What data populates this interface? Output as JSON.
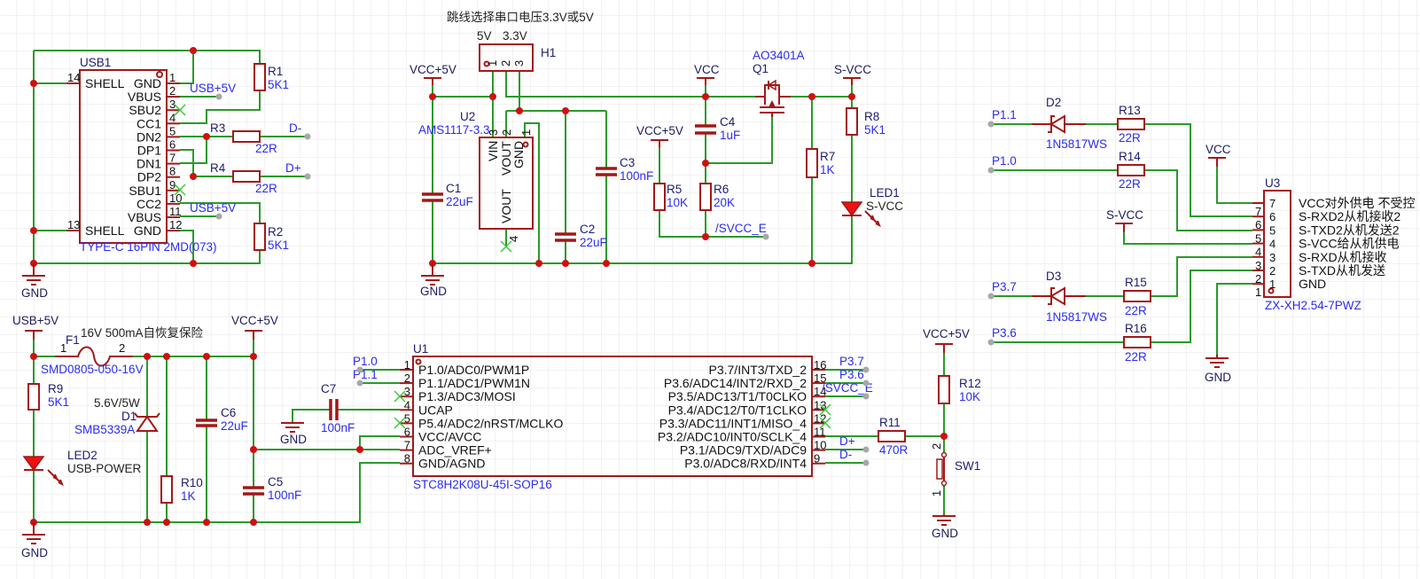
{
  "note": "跳线选择串口电压3.3V或5V",
  "nets": {
    "usb5v": "USB+5V",
    "vcc5v": "VCC+5V",
    "vcc": "VCC",
    "svcc": "S-VCC",
    "gnd": "GND",
    "dm": "D-",
    "dp": "D+",
    "p10": "P1.0",
    "p11": "P1.1",
    "p37": "P3.7",
    "p36": "P3.6",
    "svcc_e": "/SVCC_E"
  },
  "usb1": {
    "ref": "USB1",
    "part": "TYPE-C 16PIN 2MD(073)",
    "pins_right": [
      {
        "num": "1",
        "name": "GND"
      },
      {
        "num": "2",
        "name": "VBUS"
      },
      {
        "num": "3",
        "name": "SBU2"
      },
      {
        "num": "4",
        "name": "CC1"
      },
      {
        "num": "5",
        "name": "DN2"
      },
      {
        "num": "6",
        "name": "DP1"
      },
      {
        "num": "7",
        "name": "DN1"
      },
      {
        "num": "8",
        "name": "DP2"
      },
      {
        "num": "9",
        "name": "SBU1"
      },
      {
        "num": "10",
        "name": "CC2"
      },
      {
        "num": "11",
        "name": "VBUS"
      },
      {
        "num": "12",
        "name": "GND"
      }
    ],
    "pins_left": [
      {
        "num": "14",
        "name": "SHELL"
      },
      {
        "num": "13",
        "name": "SHELL"
      }
    ]
  },
  "h1": {
    "ref": "H1",
    "opt_a": "5V",
    "opt_b": "3.3V",
    "pins": [
      "1",
      "2",
      "3"
    ]
  },
  "u2": {
    "ref": "U2",
    "part": "AMS1117-3.3",
    "pins": [
      {
        "num": "3",
        "name": "VIN"
      },
      {
        "num": "2",
        "name": "VOUT"
      },
      {
        "num": "1",
        "name": "GND"
      },
      {
        "num": "4",
        "name": "VOUT"
      }
    ]
  },
  "q1": {
    "ref": "Q1",
    "part": "AO3401A"
  },
  "r": {
    "r1": {
      "ref": "R1",
      "value": "5K1"
    },
    "r2": {
      "ref": "R2",
      "value": "5K1"
    },
    "r3": {
      "ref": "R3",
      "value": "22R"
    },
    "r4": {
      "ref": "R4",
      "value": "22R"
    },
    "r5": {
      "ref": "R5",
      "value": "10K"
    },
    "r6": {
      "ref": "R6",
      "value": "20K"
    },
    "r7": {
      "ref": "R7",
      "value": "1K"
    },
    "r8": {
      "ref": "R8",
      "value": "5K1"
    },
    "r9": {
      "ref": "R9",
      "value": "5K1"
    },
    "r10": {
      "ref": "R10",
      "value": "1K"
    },
    "r11": {
      "ref": "R11",
      "value": "470R"
    },
    "r12": {
      "ref": "R12",
      "value": "10K"
    },
    "r13": {
      "ref": "R13",
      "value": "22R"
    },
    "r14": {
      "ref": "R14",
      "value": "22R"
    },
    "r15": {
      "ref": "R15",
      "value": "22R"
    },
    "r16": {
      "ref": "R16",
      "value": "22R"
    }
  },
  "c": {
    "c1": {
      "ref": "C1",
      "value": "22uF"
    },
    "c2": {
      "ref": "C2",
      "value": "22uF"
    },
    "c3": {
      "ref": "C3",
      "value": "100nF"
    },
    "c4": {
      "ref": "C4",
      "value": "1uF"
    },
    "c5": {
      "ref": "C5",
      "value": "100nF"
    },
    "c6": {
      "ref": "C6",
      "value": "22uF"
    },
    "c7": {
      "ref": "C7",
      "value": "100nF"
    }
  },
  "d": {
    "d1": {
      "ref": "D1",
      "value": "SMB5339A",
      "rating": "5.6V/5W"
    },
    "d2": {
      "ref": "D2",
      "value": "1N5817WS"
    },
    "d3": {
      "ref": "D3",
      "value": "1N5817WS"
    },
    "led1": {
      "ref": "LED1",
      "value": "S-VCC"
    },
    "led2": {
      "ref": "LED2",
      "value": "USB-POWER"
    }
  },
  "f1": {
    "ref": "F1",
    "value": "SMD0805-050-16V",
    "note": "16V 500mA自恢复保险",
    "pin1": "1",
    "pin2": "2"
  },
  "sw1": {
    "ref": "SW1",
    "pin1": "1",
    "pin2": "2"
  },
  "u1": {
    "ref": "U1",
    "part": "STC8H2K08U-45I-SOP16",
    "pins_left": [
      {
        "num": "1",
        "name": "P1.0/ADC0/PWM1P"
      },
      {
        "num": "2",
        "name": "P1.1/ADC1/PWM1N"
      },
      {
        "num": "3",
        "name": "P1.3/ADC3/MOSI"
      },
      {
        "num": "4",
        "name": "UCAP"
      },
      {
        "num": "5",
        "name": "P5.4/ADC2/nRST/MCLKO"
      },
      {
        "num": "6",
        "name": "VCC/AVCC"
      },
      {
        "num": "7",
        "name": "ADC_VREF+"
      },
      {
        "num": "8",
        "name": "GND/AGND"
      }
    ],
    "pins_right": [
      {
        "num": "16",
        "name": "P3.7/INT3/TXD_2"
      },
      {
        "num": "15",
        "name": "P3.6/ADC14/INT2/RXD_2"
      },
      {
        "num": "14",
        "name": "P3.5/ADC13/T1/T0CLKO"
      },
      {
        "num": "13",
        "name": "P3.4/ADC12/T0/T1CLKO"
      },
      {
        "num": "12",
        "name": "P3.3/ADC11/INT1/MISO_4"
      },
      {
        "num": "11",
        "name": "P3.2/ADC10/INT0/SCLK_4"
      },
      {
        "num": "10",
        "name": "P3.1/ADC9/TXD/ADC9"
      },
      {
        "num": "9",
        "name": "P3.0/ADC8/RXD/INT4"
      }
    ]
  },
  "u3": {
    "ref": "U3",
    "part": "ZX-XH2.54-7PWZ",
    "pins": [
      {
        "num": "7",
        "name": "VCC对外供电 不受控"
      },
      {
        "num": "6",
        "name": "S-RXD2从机接收2"
      },
      {
        "num": "5",
        "name": "S-TXD2从机发送2"
      },
      {
        "num": "4",
        "name": "S-VCC给从机供电"
      },
      {
        "num": "3",
        "name": "S-RXD从机接收"
      },
      {
        "num": "2",
        "name": "S-TXD从机发送"
      },
      {
        "num": "1",
        "name": "GND"
      }
    ]
  },
  "colors": {
    "wire": "#2a9a2a",
    "component": "#a31818",
    "junction": "#d01010",
    "net_label": "#2b2bf0",
    "designator": "#1c1c70",
    "no_connect": "#3cc83c"
  }
}
